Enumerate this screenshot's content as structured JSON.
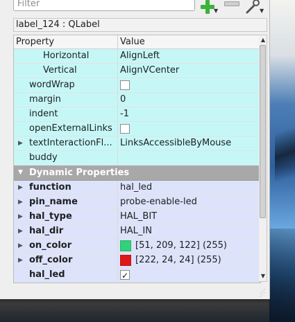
{
  "toolbar": {
    "filter_placeholder": "Filter",
    "add_icon": "plus-icon",
    "remove_icon": "minus-icon",
    "tools_icon": "wrench-icon"
  },
  "object_label": "label_124 : QLabel",
  "table": {
    "col_property": "Property",
    "col_value": "Value",
    "rows": [
      {
        "name": "Horizontal",
        "value": "AlignLeft"
      },
      {
        "name": "Vertical",
        "value": "AlignVCenter"
      },
      {
        "name": "wordWrap",
        "value": ""
      },
      {
        "name": "margin",
        "value": "0"
      },
      {
        "name": "indent",
        "value": "-1"
      },
      {
        "name": "openExternalLinks",
        "value": ""
      },
      {
        "name": "textInteractionFl...",
        "value": "LinksAccessibleByMouse"
      },
      {
        "name": "buddy",
        "value": ""
      }
    ],
    "group_title": "Dynamic Properties",
    "dynamic": [
      {
        "name": "function",
        "value": "hal_led"
      },
      {
        "name": "pin_name",
        "value": "probe-enable-led"
      },
      {
        "name": "hal_type",
        "value": "HAL_BIT"
      },
      {
        "name": "hal_dir",
        "value": "HAL_IN"
      },
      {
        "name": "on_color",
        "value": "[51, 209, 122] (255)",
        "swatch": "#33d17a"
      },
      {
        "name": "off_color",
        "value": "[222, 24, 24] (255)",
        "swatch": "#de1818"
      },
      {
        "name": "hal_led",
        "value": ""
      }
    ]
  },
  "colors": {
    "row_cyan": "#c6f7f7",
    "row_blue": "#dde3fb",
    "group_header": "#a8a8a8"
  }
}
